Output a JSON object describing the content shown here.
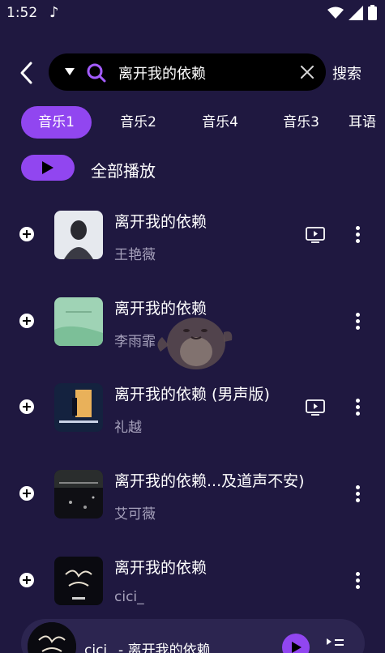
{
  "status_bar": {
    "time": "1:52"
  },
  "search": {
    "query": "离开我的依赖",
    "button_label": "搜索"
  },
  "tabs": [
    {
      "label": "音乐1",
      "active": true
    },
    {
      "label": "音乐2",
      "active": false
    },
    {
      "label": "音乐4",
      "active": false
    },
    {
      "label": "音乐3",
      "active": false
    },
    {
      "label": "耳语",
      "active": false
    }
  ],
  "play_all_label": "全部播放",
  "songs": [
    {
      "title": "离开我的依赖",
      "artist": "王艳薇",
      "has_mv": true
    },
    {
      "title": "离开我的依赖",
      "artist": "李雨霏",
      "has_mv": false
    },
    {
      "title": "离开我的依赖 (男声版)",
      "artist": "礼越",
      "has_mv": true
    },
    {
      "title": "离开我的依赖...及道声不安)",
      "artist": "艾可薇",
      "has_mv": false
    },
    {
      "title": "离开我的依赖",
      "artist": "cici_",
      "has_mv": false
    }
  ],
  "mini_player": {
    "title": "cici_ - 离开我的依赖"
  },
  "colors": {
    "background": "#1f1840",
    "accent": "#9146f0",
    "secondary_text": "#a6a1bb"
  }
}
